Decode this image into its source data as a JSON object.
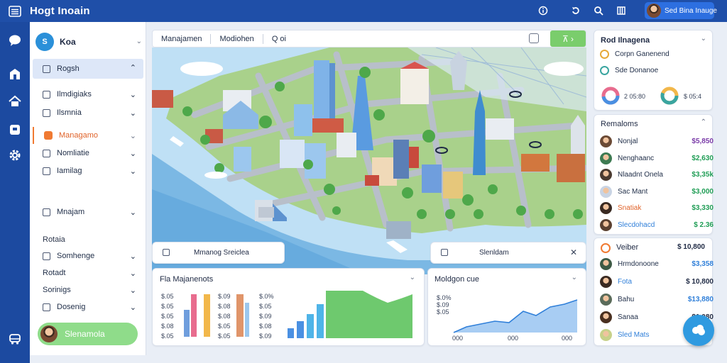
{
  "app": {
    "title": "Hogt Inoain",
    "user_name": "Sed Bina Inauge"
  },
  "sidebar": {
    "brand": "Koa",
    "items": [
      {
        "label": "Rogsh"
      },
      {
        "label": "Ilmdigiaks"
      },
      {
        "label": "Ilsmnia"
      },
      {
        "label": "Managamo"
      },
      {
        "label": "Nomliatie"
      },
      {
        "label": "Iamilag"
      },
      {
        "label": "Mnajam"
      }
    ],
    "section": {
      "label": "Rotaia"
    },
    "subitems": [
      {
        "label": "Somhenge"
      },
      {
        "label": "Rotadt"
      },
      {
        "label": "Sorinigs"
      },
      {
        "label": "Dosenig"
      }
    ],
    "cta_label": "Slenamola"
  },
  "toolbar": {
    "tab1": "Manajamen",
    "tab2": "Modiohen",
    "search": "Q  oi",
    "green_btn": "⊼  ›"
  },
  "overlay_left": {
    "label": "Mmanog  Sreiclea"
  },
  "overlay_right": {
    "label": "Slenldam"
  },
  "cards": {
    "bars": {
      "title": "Fla  Majanenots",
      "rows": [
        {
          "a": "$.05",
          "b": "$.09",
          "c": "$.0%"
        },
        {
          "a": "$.05",
          "b": "$.08",
          "c": "$.05"
        },
        {
          "a": "$.05",
          "b": "$.08",
          "c": "$.09"
        },
        {
          "a": "$.08",
          "b": "$.05",
          "c": "$.08"
        },
        {
          "a": "$.05",
          "b": "$.05",
          "c": "$.09"
        }
      ]
    },
    "line": {
      "title": "Moldgon cue",
      "ylabels": [
        "$.0%",
        "$.09",
        "$.05"
      ],
      "xlabels": [
        "000",
        "000",
        "000"
      ]
    }
  },
  "right_panel": {
    "card1": {
      "title": "Rod Ilnagena",
      "rows": [
        {
          "label": "Corpn Ganenend"
        },
        {
          "label": "Sde Donanoe"
        }
      ],
      "donut1": {
        "label": "2 05:80"
      },
      "donut2": {
        "label": "$ 05:4"
      }
    },
    "card2": {
      "title": "Remaloms",
      "rows": [
        {
          "name": "Nonjal",
          "amount": "$5,850"
        },
        {
          "name": "Nenghaanc",
          "amount": "$2,630"
        },
        {
          "name": "Nlaadnt Onela",
          "amount": "$3,35k"
        },
        {
          "name": "Sac Mant",
          "amount": "$3,000"
        },
        {
          "name": "Snatiak",
          "amount": "$3,330"
        },
        {
          "name": "Slecdohacd",
          "amount": "$ 2.36"
        }
      ]
    },
    "card3": {
      "title": "Veiber",
      "header_amount": "$ 10,800",
      "rows": [
        {
          "name": "Hrmdonoone",
          "amount": "$3,358"
        },
        {
          "name": "Fota",
          "amount": "$ 10,800"
        },
        {
          "name": "Bahu",
          "amount": "$13,880"
        },
        {
          "name": "Sanaa",
          "amount": "$1,080"
        },
        {
          "name": "Sled Mats",
          "amount": "$1,0,08"
        }
      ]
    }
  }
}
